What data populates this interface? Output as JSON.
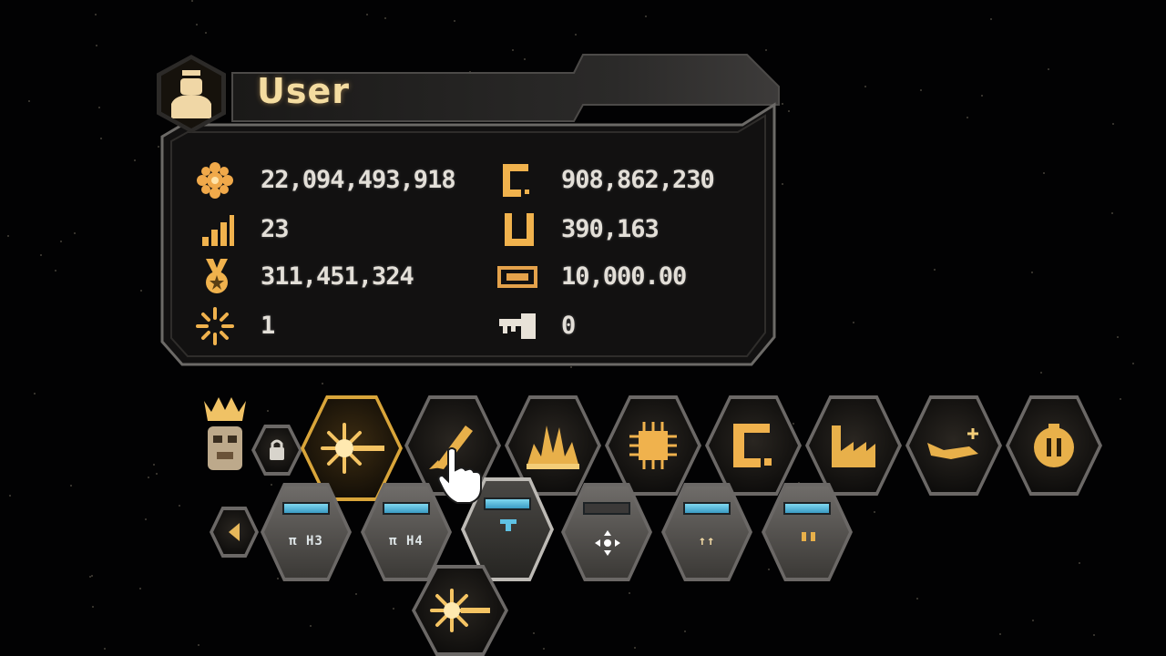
{
  "player": {
    "name": "User"
  },
  "stats": [
    {
      "icon": "credits-icon",
      "value": "22,094,493,918"
    },
    {
      "icon": "level-icon",
      "value": "23"
    },
    {
      "icon": "honor-medal-icon",
      "value": "311,451,324"
    },
    {
      "icon": "rank-burst-icon",
      "value": "1"
    },
    {
      "icon": "uridium-icon",
      "value": "908,862,230"
    },
    {
      "icon": "unit-cargo-icon",
      "value": "390,163"
    },
    {
      "icon": "ticket-icon",
      "value": "10,000.00"
    },
    {
      "icon": "key-icon",
      "value": "0"
    }
  ],
  "toolbar": {
    "categories": [
      {
        "name": "laser-category",
        "icon": "laser-burst-icon",
        "active": true
      },
      {
        "name": "rocket-category",
        "icon": "rocket-icon",
        "active": false
      },
      {
        "name": "explosive-category",
        "icon": "explosion-icon",
        "active": false
      },
      {
        "name": "cpu-category",
        "icon": "chip-icon",
        "active": false
      },
      {
        "name": "uridium-category",
        "icon": "uridium-icon",
        "active": false
      },
      {
        "name": "factory-category",
        "icon": "factory-icon",
        "active": false
      },
      {
        "name": "drone-category",
        "icon": "ship-icon",
        "active": false
      },
      {
        "name": "pause-category",
        "icon": "round-pause-icon",
        "active": false
      }
    ],
    "ammo_slots": [
      {
        "label": "π H3"
      },
      {
        "label": "π H4"
      },
      {
        "label": ""
      },
      {
        "label": ""
      },
      {
        "label": "↑↑"
      },
      {
        "label": ""
      }
    ]
  },
  "colors": {
    "accent": "#e8b04a",
    "text": "#e3dfd8",
    "panel": "#1c1b1a",
    "ammo_bar": "#5fc2e4"
  }
}
